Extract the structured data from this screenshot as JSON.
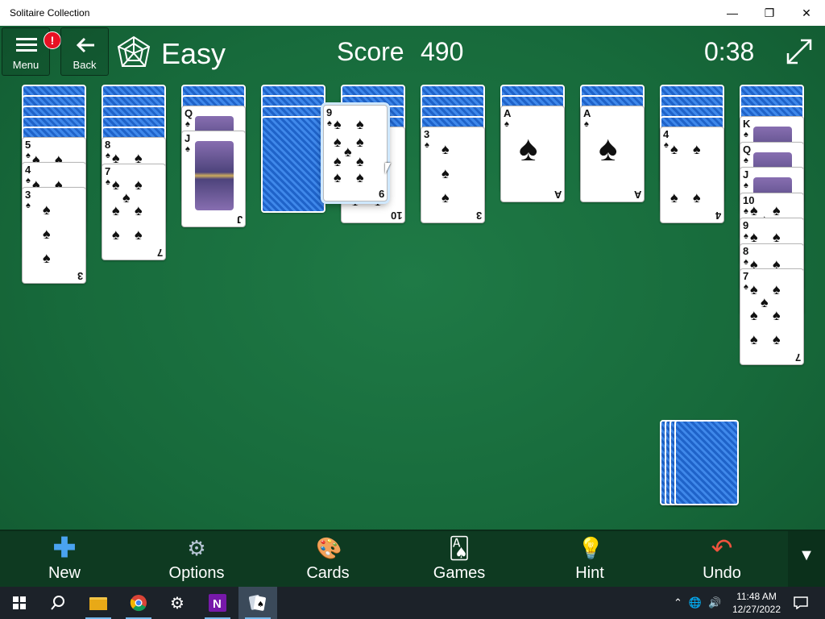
{
  "window": {
    "title": "Solitaire Collection",
    "minimize": "—",
    "restore": "❐",
    "close": "✕"
  },
  "header": {
    "menu_label": "Menu",
    "menu_badge": "!",
    "back_label": "Back",
    "mode": "Easy",
    "score_label": "Score",
    "score_value": "490",
    "timer": "0:38"
  },
  "toolbar": {
    "new_label": "New",
    "options_label": "Options",
    "cards_label": "Cards",
    "games_label": "Games",
    "hint_label": "Hint",
    "undo_label": "Undo"
  },
  "colors": {
    "felt": "#176a3b",
    "card_back": "#2f78df",
    "toolbar": "#0e3a21"
  },
  "board": {
    "tableau": [
      {
        "hidden": 5,
        "visible": [
          {
            "rank": "5"
          },
          {
            "rank": "4"
          },
          {
            "rank": "3"
          }
        ]
      },
      {
        "hidden": 5,
        "visible": [
          {
            "rank": "8"
          },
          {
            "rank": "7"
          }
        ]
      },
      {
        "hidden": 2,
        "visible": [
          {
            "rank": "Q"
          },
          {
            "rank": "J"
          }
        ]
      },
      {
        "hidden": 4,
        "visible": []
      },
      {
        "hidden": 4,
        "visible": [
          {
            "rank": "10"
          }
        ],
        "dragging": {
          "rank": "9"
        }
      },
      {
        "hidden": 4,
        "visible": [
          {
            "rank": "3"
          }
        ]
      },
      {
        "hidden": 2,
        "visible": [
          {
            "rank": "A"
          }
        ]
      },
      {
        "hidden": 2,
        "visible": [
          {
            "rank": "A"
          }
        ]
      },
      {
        "hidden": 4,
        "visible": [
          {
            "rank": "4"
          }
        ]
      },
      {
        "hidden": 3,
        "visible": [
          {
            "rank": "K"
          },
          {
            "rank": "Q"
          },
          {
            "rank": "J"
          },
          {
            "rank": "10"
          },
          {
            "rank": "9"
          },
          {
            "rank": "8"
          },
          {
            "rank": "7"
          }
        ]
      }
    ],
    "suit_symbol": "♠",
    "stock_piles": 4
  },
  "taskbar": {
    "start_icon": "windows-icon",
    "time": "11:48 AM",
    "date": "12/27/2022"
  }
}
